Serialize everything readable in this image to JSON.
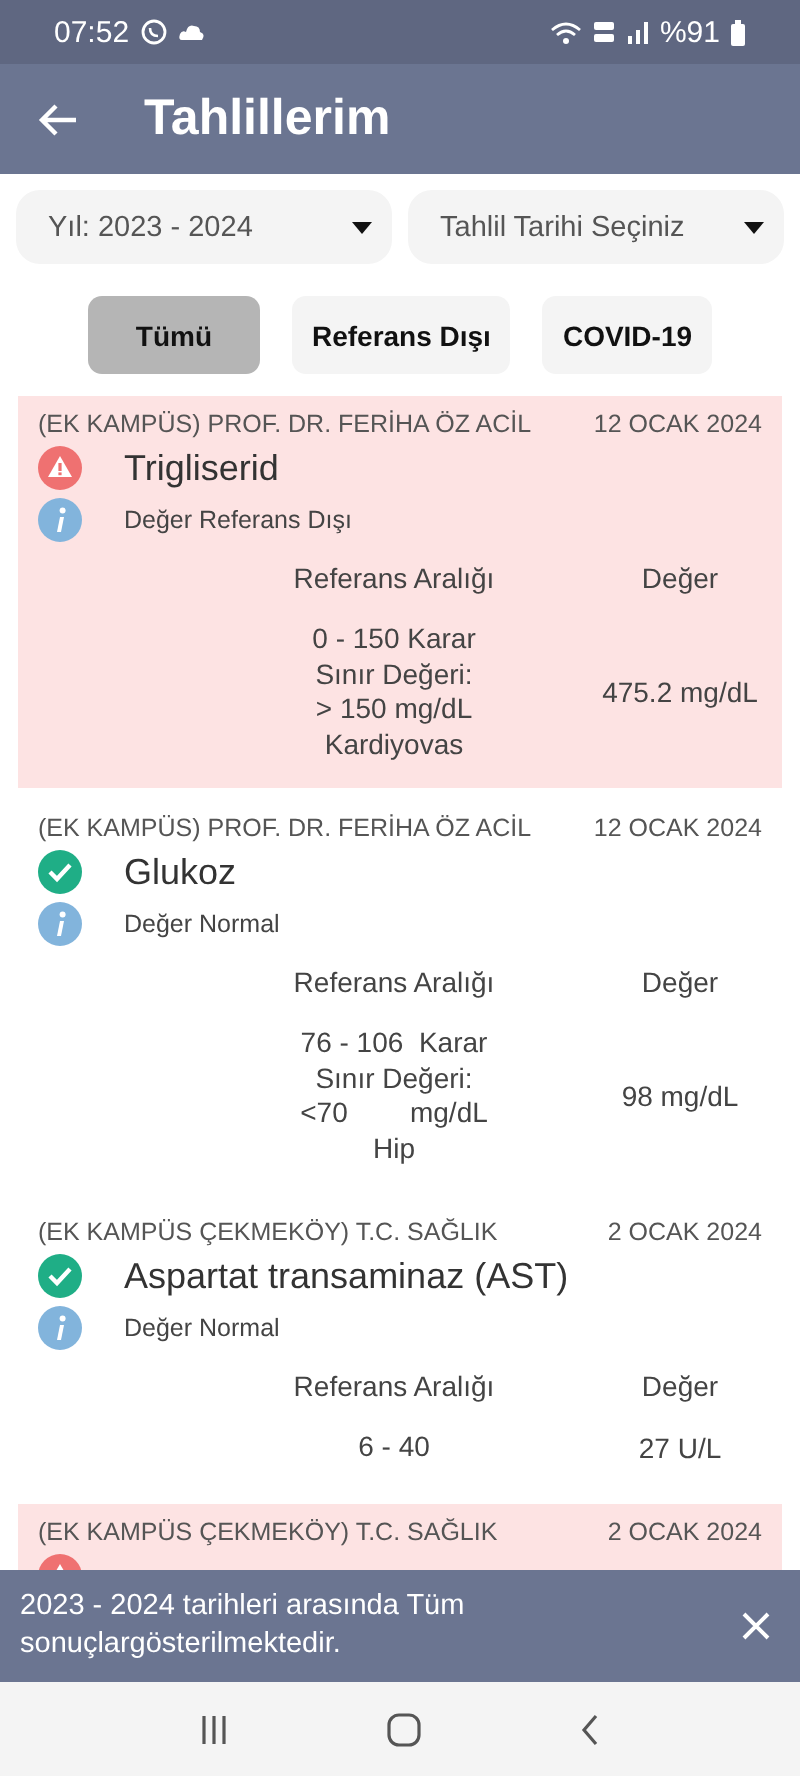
{
  "status_bar": {
    "time": "07:52",
    "battery": "%91"
  },
  "app_bar": {
    "title": "Tahlillerim"
  },
  "dropdowns": [
    {
      "value": "Yıl: 2023 - 2024"
    },
    {
      "value": "Tahlil Tarihi Seçiniz"
    }
  ],
  "filters": [
    {
      "label": "Tümü",
      "selected": true
    },
    {
      "label": "Referans Dışı",
      "selected": false
    },
    {
      "label": "COVID-19",
      "selected": false
    }
  ],
  "results": [
    {
      "institution": "(EK KAMPÜS) PROF. DR. FERİHA ÖZ ACİL",
      "date": "12 OCAK 2024",
      "kind": "out",
      "name": "Trigliserid",
      "note": "Değer Referans Dışı",
      "reference_label": "Referans Aralığı",
      "value_label": "Değer",
      "reference": "0 - 150 Karar\nSınır Değeri:\n> 150 mg/dL\nKardiyovas",
      "value": "475.2 mg/dL"
    },
    {
      "institution": "(EK KAMPÜS) PROF. DR. FERİHA ÖZ ACİL",
      "date": "12 OCAK 2024",
      "kind": "normal",
      "name": "Glukoz",
      "note": "Değer Normal",
      "reference_label": "Referans Aralığı",
      "value_label": "Değer",
      "reference": "76 - 106  Karar\nSınır Değeri:\n<70        mg/dL\nHip",
      "value": "98 mg/dL"
    },
    {
      "institution": "(EK KAMPÜS ÇEKMEKÖY) T.C. SAĞLIK",
      "date": "2 OCAK 2024",
      "kind": "normal",
      "name": "Aspartat transaminaz (AST)",
      "note": "Değer Normal",
      "reference_label": "Referans Aralığı",
      "value_label": "Değer",
      "reference": "6 - 40",
      "value": "27 U/L"
    },
    {
      "institution": "(EK KAMPÜS ÇEKMEKÖY) T.C. SAĞLIK",
      "date": "2 OCAK 2024",
      "kind": "out"
    }
  ],
  "snackbar": {
    "message": "2023 - 2024 tarihleri arasında Tüm sonuçlargösterilmektedir."
  }
}
